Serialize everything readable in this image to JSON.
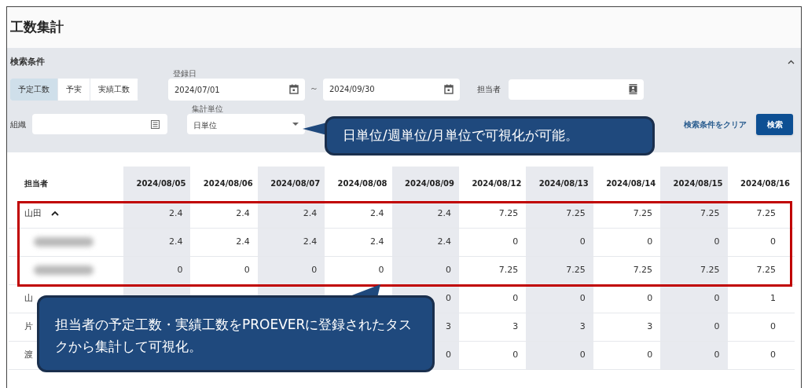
{
  "page_title": "工数集計",
  "search_panel": {
    "title": "検索条件",
    "expanded": true,
    "mode_tabs": [
      {
        "label": "予定工数",
        "selected": true
      },
      {
        "label": "予実",
        "selected": false
      },
      {
        "label": "実績工数",
        "selected": false
      }
    ],
    "date_from": {
      "label": "登録日",
      "value": "2024/07/01"
    },
    "range_separator": "～",
    "date_to": {
      "value": "2024/09/30"
    },
    "assignee": {
      "label": "担当者"
    },
    "organization": {
      "label": "組織"
    },
    "unit_select": {
      "label": "集計単位",
      "value": "日単位"
    },
    "clear_link": "検索条件をクリア",
    "search_button": "検索"
  },
  "table": {
    "columns": [
      "担当者",
      "2024/08/05",
      "2024/08/06",
      "2024/08/07",
      "2024/08/08",
      "2024/08/09",
      "2024/08/12",
      "2024/08/13",
      "2024/08/14",
      "2024/08/15",
      "2024/08/16"
    ],
    "rows": [
      {
        "name": "山田",
        "expanded": true,
        "values": [
          "2.4",
          "2.4",
          "2.4",
          "2.4",
          "2.4",
          "7.25",
          "7.25",
          "7.25",
          "7.25",
          "7.25"
        ],
        "children": [
          {
            "values": [
              "2.4",
              "2.4",
              "2.4",
              "2.4",
              "2.4",
              "0",
              "0",
              "0",
              "0",
              "0"
            ]
          },
          {
            "values": [
              "0",
              "0",
              "0",
              "0",
              "0",
              "7.25",
              "7.25",
              "7.25",
              "7.25",
              "7.25"
            ]
          }
        ]
      },
      {
        "name": "山",
        "values": [
          "0",
          "0",
          "0",
          "0",
          "0",
          "1"
        ]
      },
      {
        "name": "片",
        "values": [
          "3",
          "3",
          "3",
          "3",
          "0",
          "0"
        ]
      },
      {
        "name": "渡",
        "values": [
          "0",
          "0",
          "0",
          "0",
          "0",
          "0"
        ]
      }
    ]
  },
  "callouts": [
    {
      "text": "日単位/週単位/月単位で可視化が可能。",
      "kind": "side"
    },
    {
      "text": "担当者の予定工数・実績工数をPROEVERに登録されたタスクから集計して可視化。",
      "kind": "below"
    }
  ]
}
